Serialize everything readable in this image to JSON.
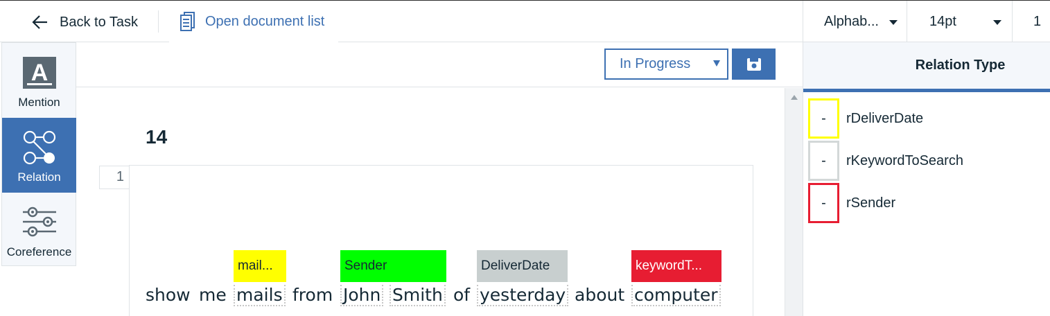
{
  "topbar": {
    "back_label": "Back to Task",
    "doc_list_label": "Open document list",
    "sort_value": "Alphab...",
    "font_size_value": "14pt",
    "page_value": "1"
  },
  "tools": [
    {
      "label": "Mention",
      "icon": "mention-icon"
    },
    {
      "label": "Relation",
      "icon": "relation-icon"
    },
    {
      "label": "Coreference",
      "icon": "coreference-icon"
    }
  ],
  "action_bar": {
    "status_value": "In Progress",
    "save_icon": "save-icon"
  },
  "document": {
    "title": "14",
    "line_number": "1",
    "tokens": [
      "show",
      "me",
      "mails",
      "from",
      "John",
      "Smith",
      "of",
      "yesterday",
      "about",
      "computer"
    ],
    "labels": [
      {
        "text": "mail...",
        "color": "#ffff00",
        "text_color": "#152935"
      },
      {
        "text": "Sender",
        "color": "#00ff00",
        "text_color": "#152935"
      },
      {
        "text": "DeliverDate",
        "color": "#c8cfcf",
        "text_color": "#152935"
      },
      {
        "text": "keywordT...",
        "color": "#e71d32",
        "text_color": "#ffffff"
      }
    ]
  },
  "relation_panel": {
    "title": "Relation Type",
    "items": [
      {
        "key": "-",
        "name": "rDeliverDate",
        "color": "#ffff00"
      },
      {
        "key": "-",
        "name": "rKeywordToSearch",
        "color": "#d3d8d8"
      },
      {
        "key": "-",
        "name": "rSender",
        "color": "#e71d32"
      }
    ]
  },
  "colors": {
    "accent": "#3d70b2"
  }
}
